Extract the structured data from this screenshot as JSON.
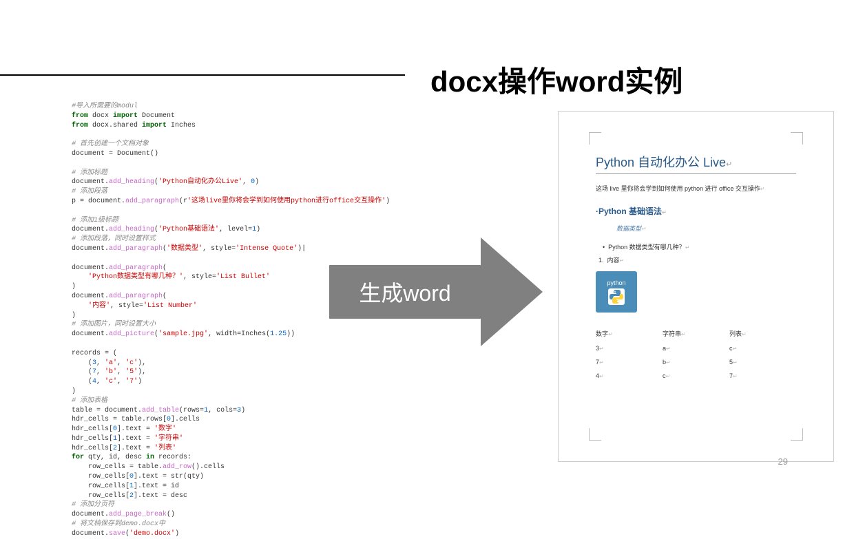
{
  "title": "docx操作word实例",
  "arrow_label": "生成word",
  "page_number": "29",
  "code": {
    "l1": "#导入所需要的modul",
    "l2a": "from",
    "l2b": " docx ",
    "l2c": "import",
    "l2d": " Document",
    "l3a": "from",
    "l3b": " docx.shared ",
    "l3c": "import",
    "l3d": " Inches",
    "l5": "# 首先创建一个文档对象",
    "l6": "document = Document()",
    "l8": "# 添加标题",
    "l9a": "document.",
    "l9b": "add_heading",
    "l9c": "(",
    "l9d": "'Python自动化办公Live'",
    "l9e": ", ",
    "l9f": "0",
    "l9g": ")",
    "l10": "# 添加段落",
    "l11a": "p = document.",
    "l11b": "add_paragraph",
    "l11c": "(r",
    "l11d": "'这场live里你将会学到如何使用python进行office交互操作'",
    "l11e": ")",
    "l13": "# 添加1级标题",
    "l14a": "document.",
    "l14b": "add_heading",
    "l14c": "(",
    "l14d": "'Python基础语法'",
    "l14e": ", level=",
    "l14f": "1",
    "l14g": ")",
    "l15": "# 添加段落，同时设置样式",
    "l16a": "document.",
    "l16b": "add_paragraph",
    "l16c": "(",
    "l16d": "'数据类型'",
    "l16e": ", style=",
    "l16f": "'Intense Quote'",
    "l16g": ")|",
    "l18a": "document.",
    "l18b": "add_paragraph",
    "l18c": "(",
    "l19a": "    ",
    "l19b": "'Python数据类型有哪几种？'",
    "l19c": ", style=",
    "l19d": "'List Bullet'",
    "l20": ")",
    "l21a": "document.",
    "l21b": "add_paragraph",
    "l21c": "(",
    "l22a": "    ",
    "l22b": "'内容'",
    "l22c": ", style=",
    "l22d": "'List Number'",
    "l23": ")",
    "l24": "# 添加图片，同时设置大小",
    "l25a": "document.",
    "l25b": "add_picture",
    "l25c": "(",
    "l25d": "'sample.jpg'",
    "l25e": ", width=Inches(",
    "l25f": "1.25",
    "l25g": "))",
    "l27": "records = (",
    "l28a": "    (",
    "l28b": "3",
    "l28c": ", ",
    "l28d": "'a'",
    "l28e": ", ",
    "l28f": "'c'",
    "l28g": "),",
    "l29a": "    (",
    "l29b": "7",
    "l29c": ", ",
    "l29d": "'b'",
    "l29e": ", ",
    "l29f": "'5'",
    "l29g": "),",
    "l30a": "    (",
    "l30b": "4",
    "l30c": ", ",
    "l30d": "'c'",
    "l30e": ", ",
    "l30f": "'7'",
    "l30g": ")",
    "l31": ")",
    "l32": "# 添加表格",
    "l33a": "table = document.",
    "l33b": "add_table",
    "l33c": "(rows=",
    "l33d": "1",
    "l33e": ", cols=",
    "l33f": "3",
    "l33g": ")",
    "l34a": "hdr_cells = table.rows[",
    "l34b": "0",
    "l34c": "].cells",
    "l35a": "hdr_cells[",
    "l35b": "0",
    "l35c": "].text = ",
    "l35d": "'数字'",
    "l36a": "hdr_cells[",
    "l36b": "1",
    "l36c": "].text = ",
    "l36d": "'字符串'",
    "l37a": "hdr_cells[",
    "l37b": "2",
    "l37c": "].text = ",
    "l37d": "'列表'",
    "l38a": "for",
    "l38b": " qty, id, desc ",
    "l38c": "in",
    "l38d": " records:",
    "l39a": "    row_cells = table.",
    "l39b": "add_row",
    "l39c": "().cells",
    "l40a": "    row_cells[",
    "l40b": "0",
    "l40c": "].text = str(qty)",
    "l41a": "    row_cells[",
    "l41b": "1",
    "l41c": "].text = id",
    "l42a": "    row_cells[",
    "l42b": "2",
    "l42c": "].text = desc",
    "l43": "# 添加分页符",
    "l44a": "document.",
    "l44b": "add_page_break",
    "l44c": "()",
    "l45": "# 将文档保存到demo.docx中",
    "l46a": "document.",
    "l46b": "save",
    "l46c": "(",
    "l46d": "'demo.docx'",
    "l46e": ")"
  },
  "word": {
    "h1": "Python 自动化办公 Live",
    "p1": "这场 live 里你将会学到如何使用 python 进行 office 交互操作",
    "h2": "Python 基础语法",
    "quote": "数据类型",
    "bullet": "Python 数据类型有哪几种？",
    "numitem": "内容",
    "img_label": "python",
    "table": {
      "h1": "数字",
      "h2": "字符串",
      "h3": "列表",
      "r1c1": "3",
      "r1c2": "a",
      "r1c3": "c",
      "r2c1": "7",
      "r2c2": "b",
      "r2c3": "5",
      "r3c1": "4",
      "r3c2": "c",
      "r3c3": "7"
    }
  }
}
